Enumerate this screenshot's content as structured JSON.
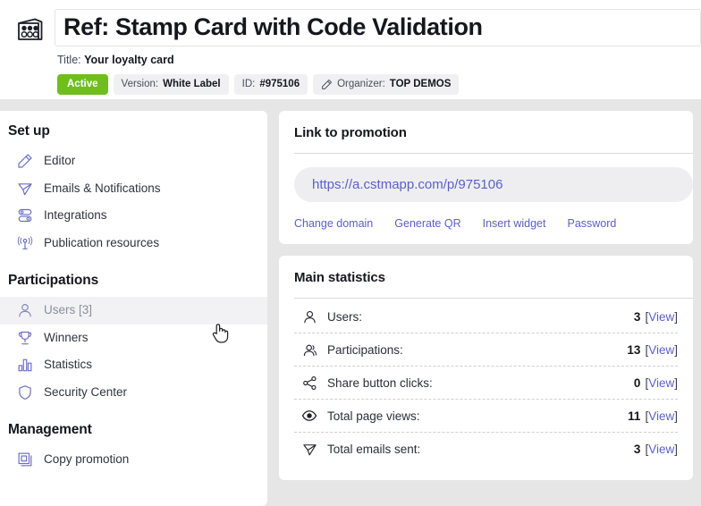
{
  "header": {
    "promo_icon": "stamp-card-icon",
    "title_value": "Ref: Stamp Card with Code Validation",
    "title_placeholder": "Promotion reference",
    "subtitle_label": "Title:",
    "subtitle_value": "Your loyalty card",
    "badges": {
      "status": "Active",
      "version_label": "Version:",
      "version_value": "White Label",
      "id_label": "ID:",
      "id_value": "#975106",
      "organizer_icon": "pencil-icon",
      "organizer_label": "Organizer:",
      "organizer_value": "TOP DEMOS"
    }
  },
  "sidebar": {
    "sections": [
      {
        "heading": "Set up",
        "items": [
          {
            "label": "Editor",
            "icon": "pencil-icon",
            "active": false
          },
          {
            "label": "Emails & Notifications",
            "icon": "paper-plane-icon",
            "active": false
          },
          {
            "label": "Integrations",
            "icon": "toggles-icon",
            "active": false
          },
          {
            "label": "Publication resources",
            "icon": "broadcast-icon",
            "active": false
          }
        ]
      },
      {
        "heading": "Participations",
        "items": [
          {
            "label": "Users [3]",
            "icon": "user-icon",
            "active": true
          },
          {
            "label": "Winners",
            "icon": "trophy-icon",
            "active": false
          },
          {
            "label": "Statistics",
            "icon": "bar-chart-icon",
            "active": false
          },
          {
            "label": "Security Center",
            "icon": "shield-icon",
            "active": false
          }
        ]
      },
      {
        "heading": "Management",
        "items": [
          {
            "label": "Copy promotion",
            "icon": "copy-icon",
            "active": false
          }
        ]
      }
    ]
  },
  "link_card": {
    "title": "Link to promotion",
    "url": "https://a.cstmapp.com/p/975106",
    "actions": [
      "Change domain",
      "Generate QR",
      "Insert widget",
      "Password"
    ]
  },
  "stats_card": {
    "title": "Main statistics",
    "view_label": "View",
    "rows": [
      {
        "icon": "user-icon",
        "label": "Users:",
        "value": "3"
      },
      {
        "icon": "participant-icon",
        "label": "Participations:",
        "value": "13"
      },
      {
        "icon": "share-icon",
        "label": "Share button clicks:",
        "value": "0"
      },
      {
        "icon": "eye-icon",
        "label": "Total page views:",
        "value": "11"
      },
      {
        "icon": "paper-plane-icon",
        "label": "Total emails sent:",
        "value": "3"
      }
    ]
  },
  "colors": {
    "accent": "#5b5fc7",
    "status_active": "#6fbe1e",
    "page_bg": "#e6e6e6",
    "card_bg": "#ffffff"
  }
}
